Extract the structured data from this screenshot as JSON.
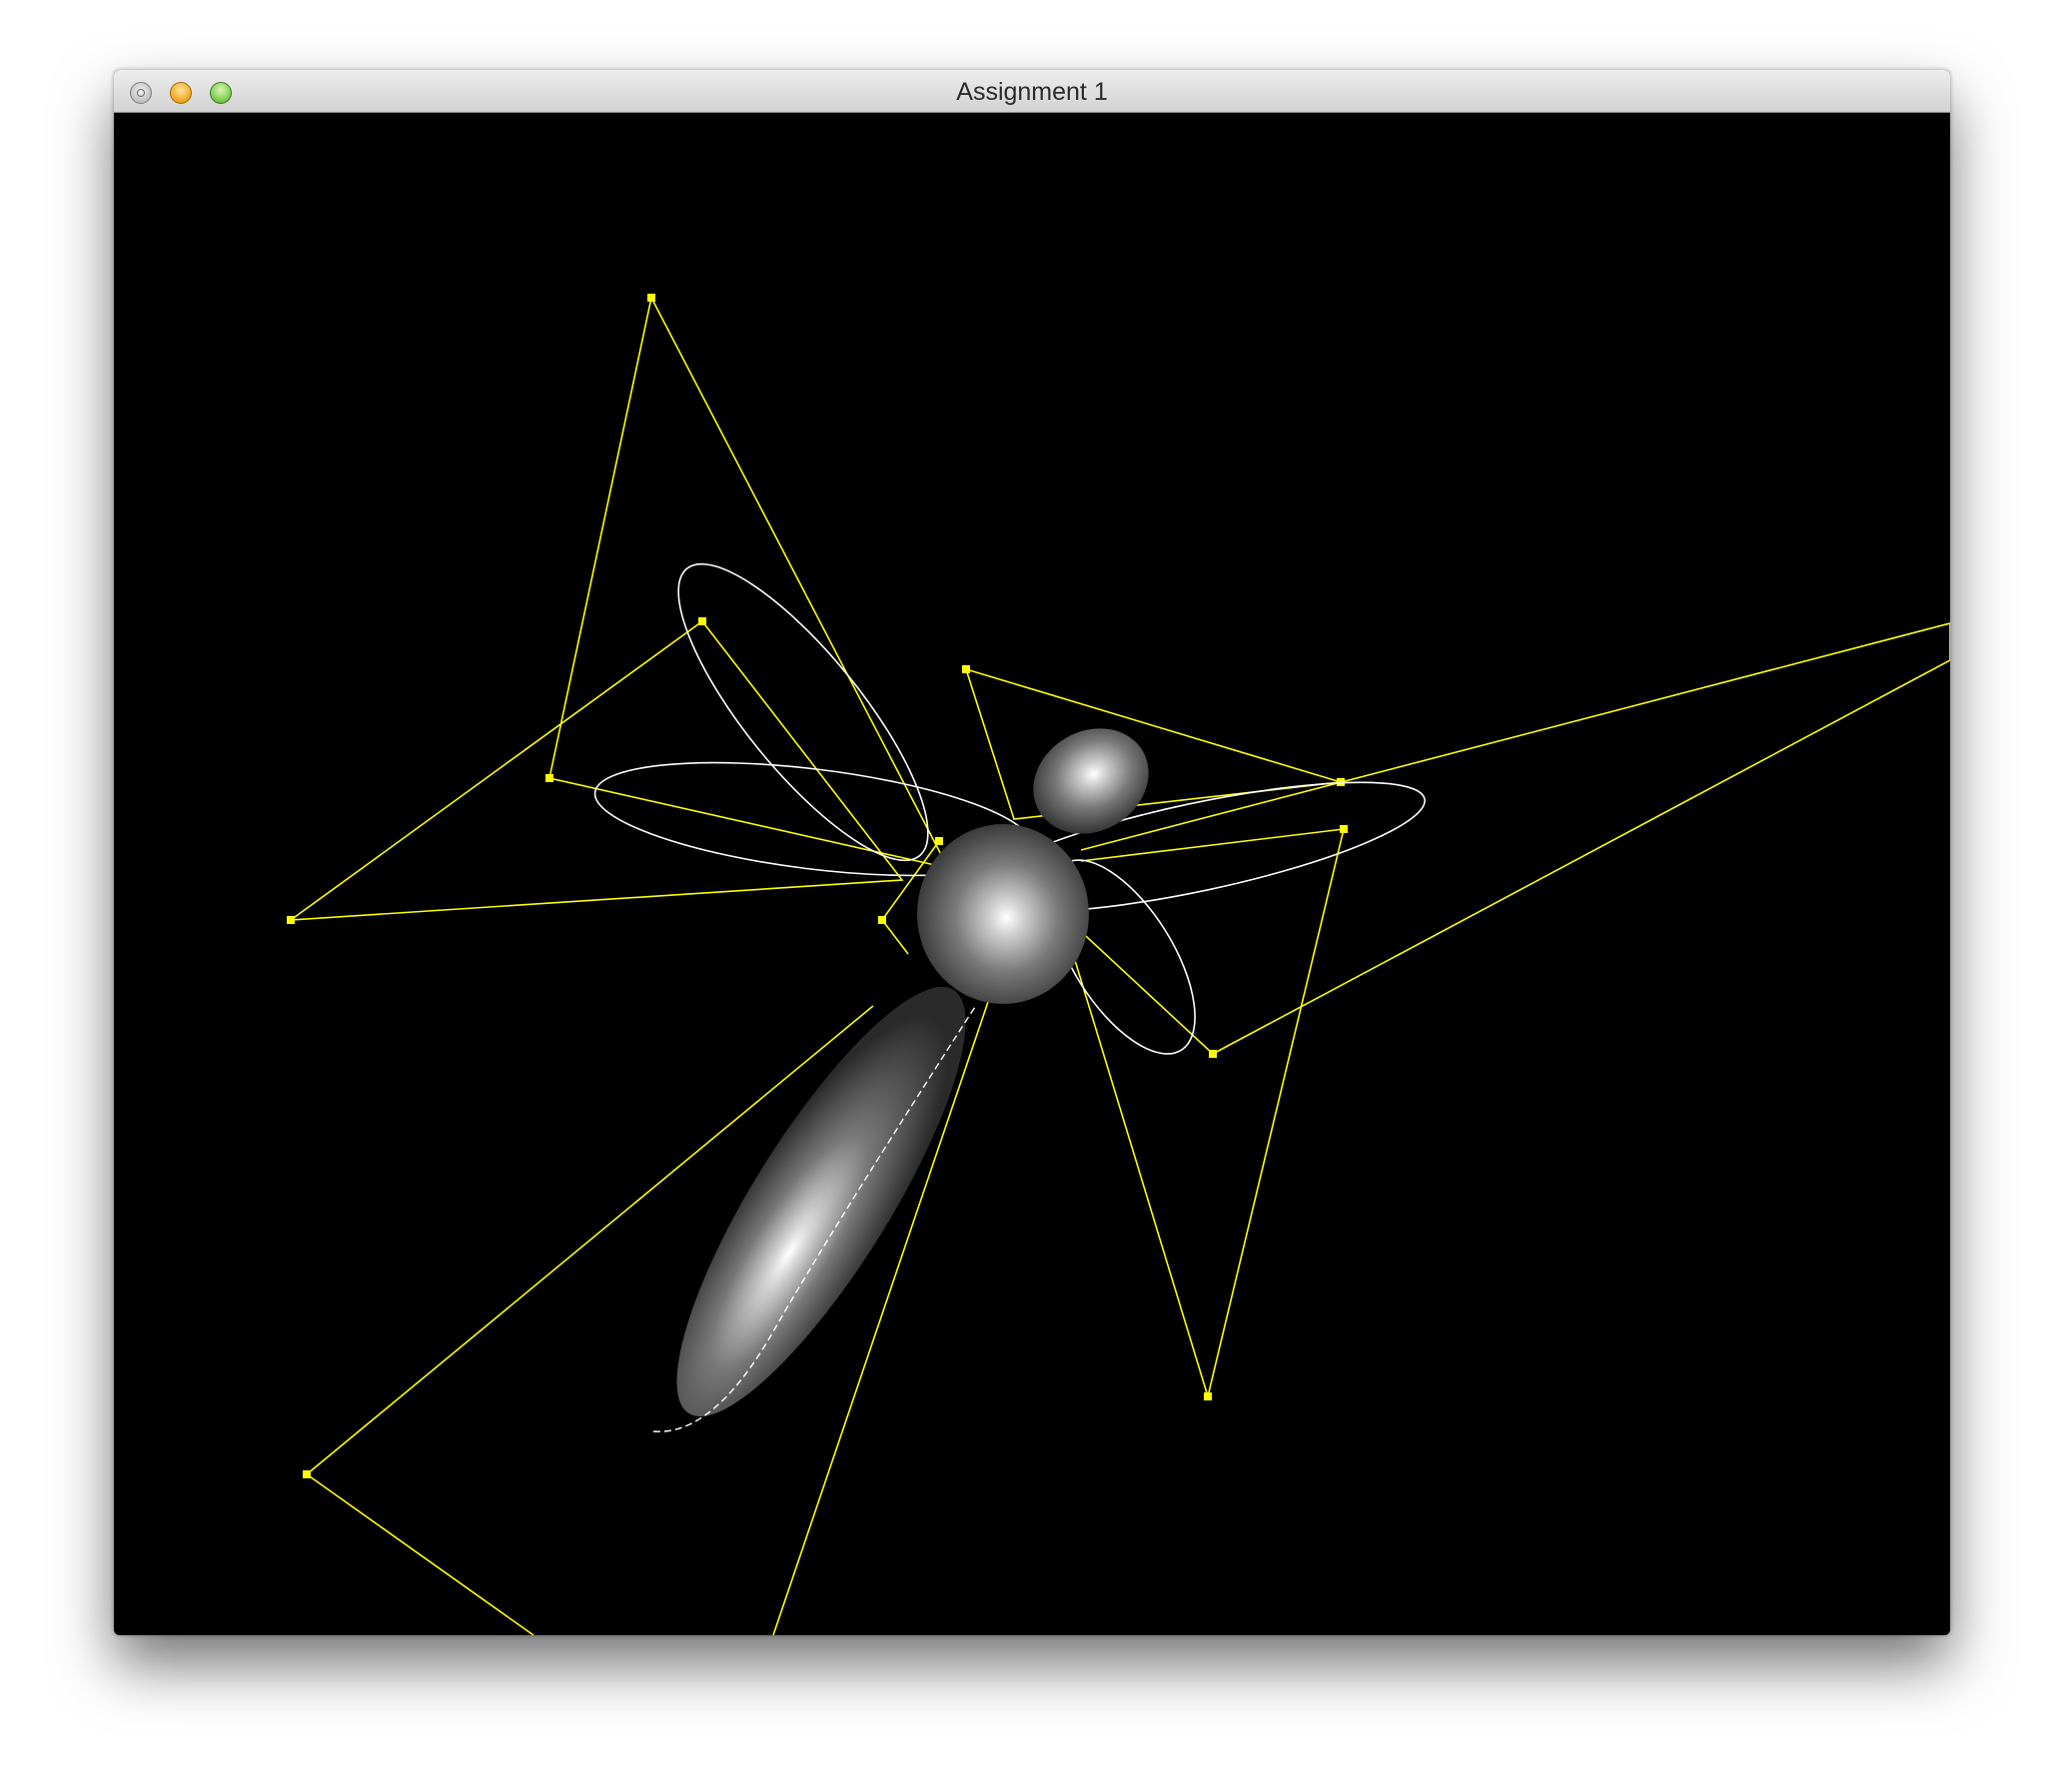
{
  "window": {
    "title": "Assignment 1",
    "traffic_lights": [
      "close-button",
      "minimize-button",
      "zoom-button"
    ]
  },
  "scene": {
    "background_color": "#000000",
    "control_polygon_color": "#ffff00",
    "curve_color": "#ffffff",
    "body_color": "#7a7a7a"
  }
}
